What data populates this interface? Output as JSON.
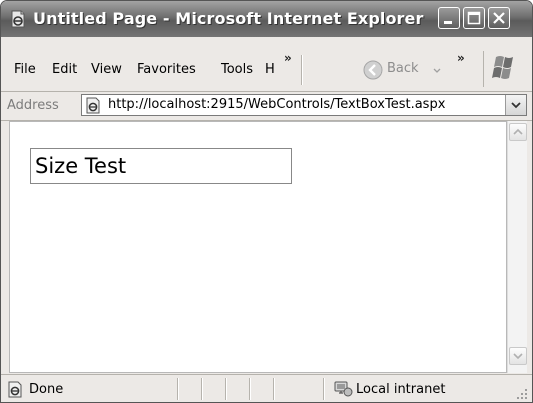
{
  "window": {
    "title": "Untitled Page - Microsoft Internet Explorer"
  },
  "menu": {
    "items": [
      {
        "label": "File"
      },
      {
        "label": "Edit"
      },
      {
        "label": "View"
      },
      {
        "label": "Favorites"
      },
      {
        "label": "Tools"
      },
      {
        "label": "H"
      }
    ],
    "overflow_label": "»",
    "back_label": "Back",
    "toolbar_overflow_label": "»"
  },
  "address": {
    "label": "Address",
    "url": "http://localhost:2915/WebControls/TextBoxTest.aspx"
  },
  "page": {
    "textbox_value": "Size Test"
  },
  "status": {
    "text": "Done",
    "zone": "Local intranet"
  },
  "icons": {
    "app": "ie-page-icon",
    "minimize": "minimize-icon",
    "maximize": "maximize-icon",
    "close": "close-icon",
    "back": "back-arrow-icon",
    "logo": "windows-flag-icon",
    "address_page": "ie-page-icon",
    "dropdown": "chevron-down-icon",
    "scroll_up": "scroll-up-icon",
    "scroll_down": "scroll-down-icon",
    "status_page": "ie-page-icon",
    "zone": "local-intranet-icon",
    "resize": "resize-grip-icon"
  }
}
